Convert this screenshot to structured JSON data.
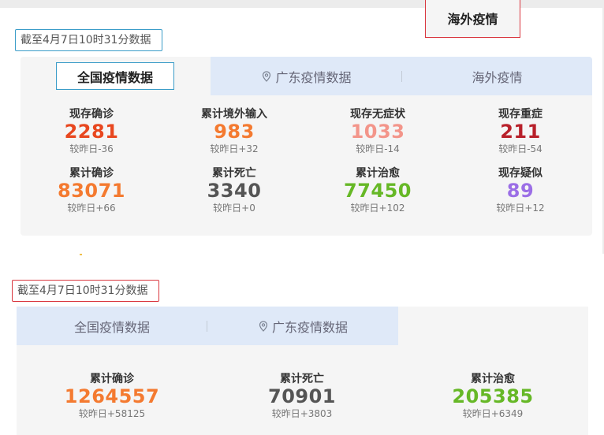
{
  "colors": {
    "red": "#e8471f",
    "orange": "#f47a30",
    "salmon": "#f3958a",
    "darkred": "#b8202a",
    "gray": "#555555",
    "green": "#66b826",
    "purple": "#9b6ee6"
  },
  "top": {
    "date": "截至4月7日10时31分数据",
    "tabs": [
      {
        "label": "全国疫情数据",
        "active": true
      },
      {
        "label": "广东疫情数据",
        "icon": "location-pin-icon"
      },
      {
        "label": "海外疫情"
      }
    ],
    "stats": [
      {
        "label": "现存确诊",
        "value": "2281",
        "change": "较昨日-36",
        "color": "red"
      },
      {
        "label": "累计境外输入",
        "value": "983",
        "change": "较昨日+32",
        "color": "orange"
      },
      {
        "label": "现存无症状",
        "value": "1033",
        "change": "较昨日-14",
        "color": "salmon"
      },
      {
        "label": "现存重症",
        "value": "211",
        "change": "较昨日-54",
        "color": "darkred"
      },
      {
        "label": "累计确诊",
        "value": "83071",
        "change": "较昨日+66",
        "color": "orange"
      },
      {
        "label": "累计死亡",
        "value": "3340",
        "change": "较昨日+0",
        "color": "gray"
      },
      {
        "label": "累计治愈",
        "value": "77450",
        "change": "较昨日+102",
        "color": "green"
      },
      {
        "label": "现存疑似",
        "value": "89",
        "change": "较昨日+12",
        "color": "purple"
      }
    ]
  },
  "bottom": {
    "date": "截至4月7日10时31分数据",
    "tabs": [
      {
        "label": "全国疫情数据"
      },
      {
        "label": "广东疫情数据",
        "icon": "location-pin-icon"
      },
      {
        "label": "海外疫情",
        "active": true
      }
    ],
    "stats": [
      {
        "label": "累计确诊",
        "value": "1264557",
        "change": "较昨日+58125",
        "color": "orange"
      },
      {
        "label": "累计死亡",
        "value": "70901",
        "change": "较昨日+3803",
        "color": "gray"
      },
      {
        "label": "累计治愈",
        "value": "205385",
        "change": "较昨日+6349",
        "color": "green"
      }
    ]
  }
}
